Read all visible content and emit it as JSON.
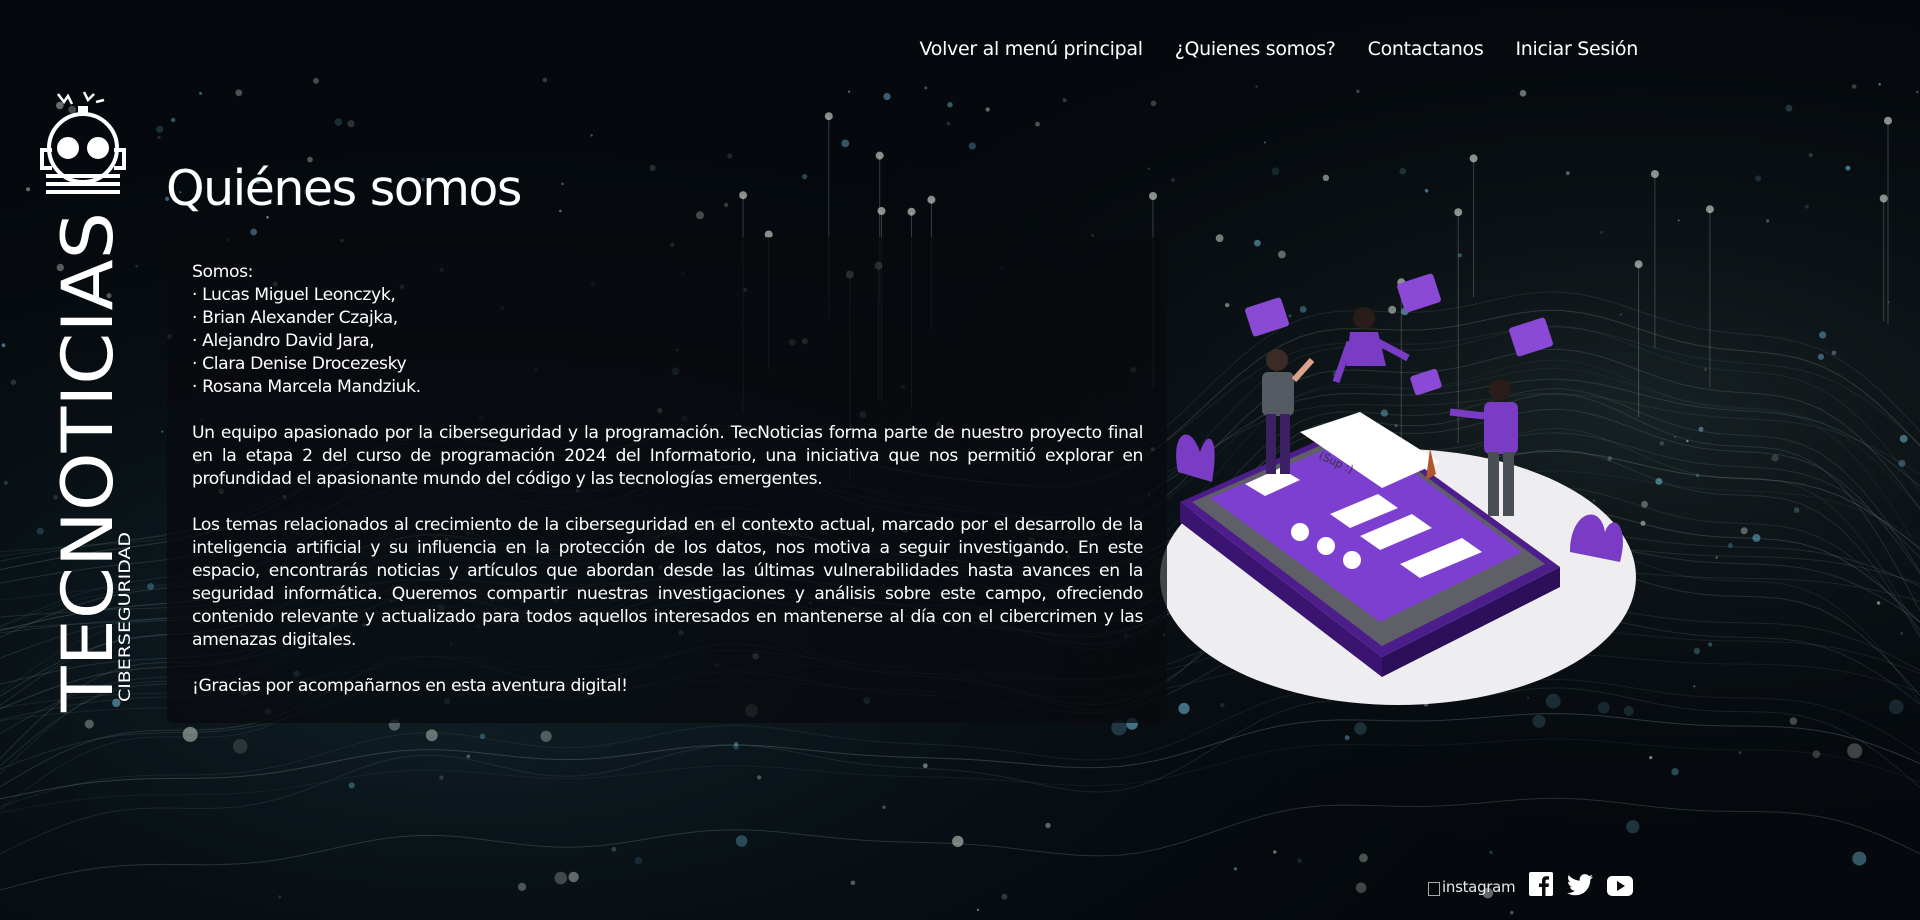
{
  "nav": {
    "items": [
      "Volver al menú principal",
      "¿Quienes somos?",
      "Contactanos",
      "Iniciar Sesión"
    ]
  },
  "brand": {
    "name": "TECNOTICIAS",
    "tagline": "CIBERSEGURIDAD",
    "logo_icon": "robot-icon"
  },
  "page": {
    "title": "Quiénes somos"
  },
  "content": {
    "intro": "Somos:",
    "members": [
      "· Lucas Miguel Leonczyk,",
      "· Brian Alexander Czajka,",
      "· Alejandro David Jara,",
      "· Clara Denise Drocezesky",
      "· Rosana Marcela Mandziuk."
    ],
    "paragraph1": "Un equipo apasionado por la ciberseguridad y la programación. TecNoticias forma parte de nuestro proyecto final en la etapa 2 del curso de programación 2024 del Informatorio, una iniciativa que nos permitió explorar en profundidad el apasionante mundo del código y las tecnologías emergentes.",
    "paragraph2": "Los temas relacionados al crecimiento de la ciberseguridad en el contexto actual, marcado por el desarrollo de la inteligencia artificial y su influencia en la protección de los datos, nos motiva a seguir investigando. En este espacio, encontrarás noticias y artículos que abordan desde las últimas vulnerabilidades hasta avances en la seguridad informática. Queremos compartir nuestras investigaciones y análisis sobre este campo, ofreciendo contenido relevante y actualizado para todos aquellos interesados en mantenerse al día con el cibercrimen y las amenazas digitales.",
    "closing": "¡Gracias por acompañarnos en esta aventura digital!"
  },
  "illustration": {
    "icon": "team-chat-phone-illustration",
    "chat_bubble_text": "(Sup :)"
  },
  "social": {
    "instagram_alt": "instagram",
    "icons": [
      "instagram-icon",
      "facebook-icon",
      "twitter-icon",
      "youtube-icon"
    ]
  },
  "colors": {
    "background": "#05090d",
    "accent_purple": "#6a2fb0",
    "text": "#ffffff",
    "panel": "#080a0e"
  }
}
